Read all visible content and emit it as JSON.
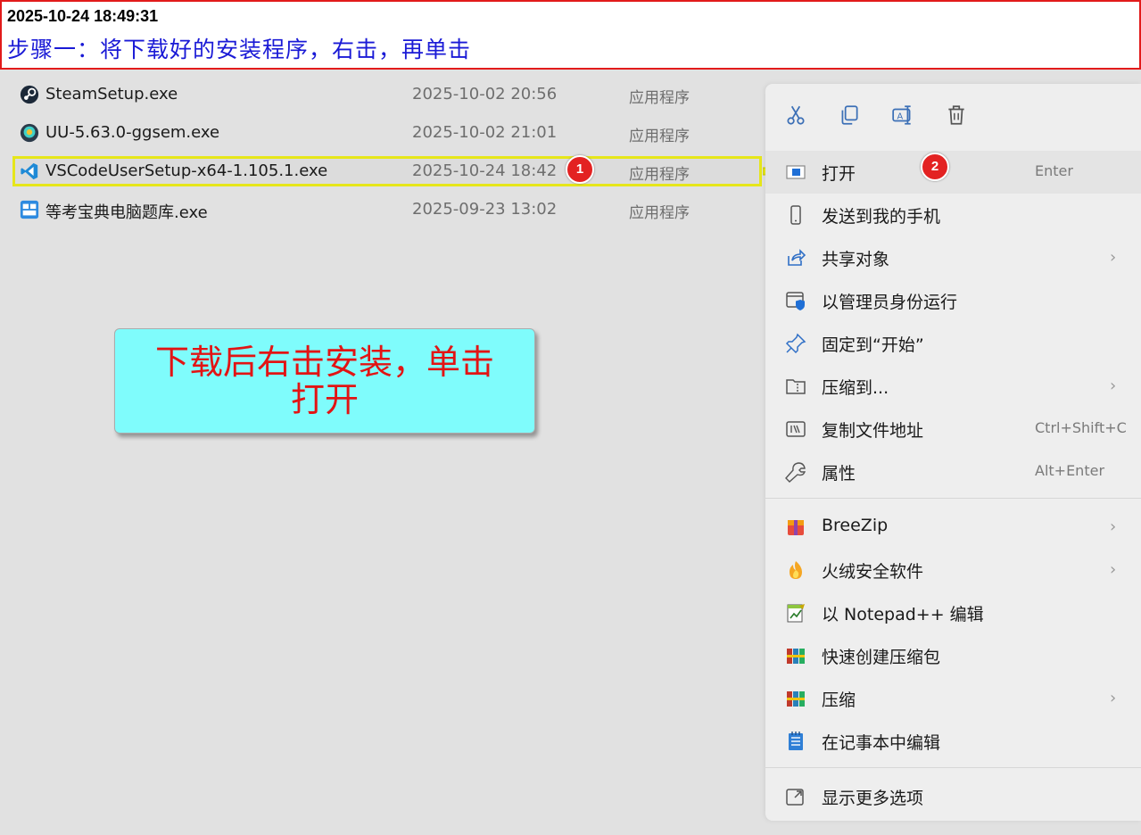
{
  "banner": {
    "timestamp": "2025-10-24 18:49:31",
    "step": "步骤一：将下载好的安装程序，右击，再单击"
  },
  "files": [
    {
      "name": "SteamSetup.exe",
      "date": "2025-10-02 20:56",
      "type": "应用程序",
      "icon": "steam-icon"
    },
    {
      "name": "UU-5.63.0-ggsem.exe",
      "date": "2025-10-02 21:01",
      "type": "应用程序",
      "icon": "uu-icon"
    },
    {
      "name": "VSCodeUserSetup-x64-1.105.1.exe",
      "date": "2025-10-24 18:42",
      "type": "应用程序",
      "icon": "vscode-icon",
      "selected": true
    },
    {
      "name": "等考宝典电脑题库.exe",
      "date": "2025-09-23 13:02",
      "type": "应用程序",
      "icon": "exam-app-icon"
    }
  ],
  "badges": {
    "one": "1",
    "two": "2"
  },
  "callout": {
    "line1": "下载后右击安装，单击",
    "line2": "打开"
  },
  "menu": {
    "toolbar": [
      "cut-icon",
      "copy-icon",
      "rename-icon",
      "delete-icon"
    ],
    "items": [
      {
        "label": "打开",
        "shortcut": "Enter",
        "icon": "open-icon"
      },
      {
        "label": "发送到我的手机",
        "shortcut": "",
        "icon": "phone-icon"
      },
      {
        "label": "共享对象",
        "shortcut": "",
        "icon": "share-icon",
        "submenu": true
      },
      {
        "label": "以管理员身份运行",
        "shortcut": "",
        "icon": "admin-shield-icon"
      },
      {
        "label": "固定到“开始”",
        "shortcut": "",
        "icon": "pin-icon"
      },
      {
        "label": "压缩到...",
        "shortcut": "",
        "icon": "zip-folder-icon",
        "submenu": true
      },
      {
        "label": "复制文件地址",
        "shortcut": "Ctrl+Shift+C",
        "icon": "copy-path-icon"
      },
      {
        "label": "属性",
        "shortcut": "Alt+Enter",
        "icon": "wrench-icon"
      },
      {
        "label": "BreeZip",
        "shortcut": "",
        "icon": "breezip-icon",
        "submenu": true
      },
      {
        "label": "火绒安全软件",
        "shortcut": "",
        "icon": "huorong-icon",
        "submenu": true
      },
      {
        "label": "以 Notepad++ 编辑",
        "shortcut": "",
        "icon": "notepadpp-icon"
      },
      {
        "label": "快速创建压缩包",
        "shortcut": "",
        "icon": "winrar-icon"
      },
      {
        "label": "压缩",
        "shortcut": "",
        "icon": "winrar-icon",
        "submenu": true
      },
      {
        "label": "在记事本中编辑",
        "shortcut": "",
        "icon": "notepad-icon"
      },
      {
        "label": "显示更多选项",
        "shortcut": "",
        "icon": "more-options-icon"
      }
    ],
    "submenu_arrow": "›"
  },
  "colors": {
    "banner_border": "#e21b1b",
    "step_text": "#1a1ad6",
    "highlight_border": "#e6e61a",
    "badge": "#e32222",
    "callout_bg": "#7ffcfc",
    "callout_text": "#e21414"
  }
}
